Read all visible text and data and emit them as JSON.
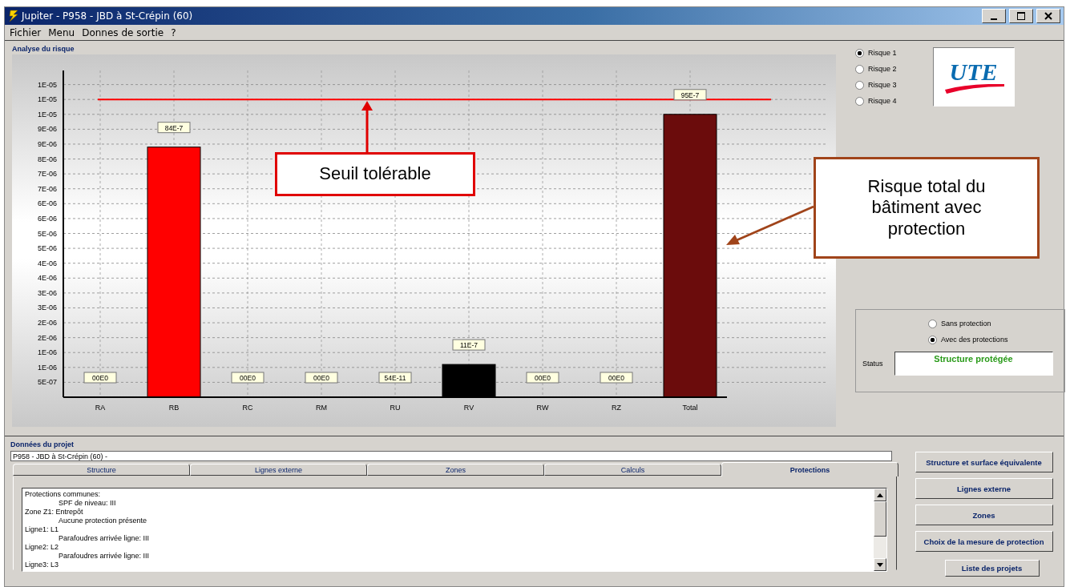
{
  "window": {
    "title": "Jupiter - P958 -  JBD à St-Crépin (60)"
  },
  "menu": [
    "Fichier",
    "Menu",
    "Donnes de sortie",
    "?"
  ],
  "analysis": {
    "title": "Analyse du risque",
    "chart_data": {
      "type": "bar",
      "categories": [
        "RA",
        "RB",
        "RC",
        "RM",
        "RU",
        "RV",
        "RW",
        "RZ",
        "Total"
      ],
      "series": [
        {
          "color": "#ff0000",
          "values": [
            0,
            8.4e-06,
            0,
            0,
            5.4e-10,
            null,
            0,
            0,
            null
          ]
        },
        {
          "color": "#000000",
          "values": [
            null,
            null,
            null,
            null,
            null,
            1.1e-06,
            null,
            null,
            null
          ]
        },
        {
          "color": "#6b0c0c",
          "values": [
            null,
            null,
            null,
            null,
            null,
            null,
            null,
            null,
            9.5e-06
          ]
        }
      ],
      "grid": true,
      "value_labels": [
        "00E0",
        "84E-7",
        "00E0",
        "00E0",
        "54E-11",
        "11E-7",
        "00E0",
        "00E0",
        "95E-7"
      ],
      "ylim": [
        0,
        1.1e-05
      ],
      "yticks": [
        {
          "value": 5e-07,
          "label": "5E-07"
        },
        {
          "value": 1e-06,
          "label": "1E-06"
        },
        {
          "value": 1.5e-06,
          "label": "1E-06"
        },
        {
          "value": 2e-06,
          "label": "2E-06"
        },
        {
          "value": 2.5e-06,
          "label": "2E-06"
        },
        {
          "value": 3e-06,
          "label": "3E-06"
        },
        {
          "value": 3.5e-06,
          "label": "3E-06"
        },
        {
          "value": 4e-06,
          "label": "4E-06"
        },
        {
          "value": 4.5e-06,
          "label": "4E-06"
        },
        {
          "value": 5e-06,
          "label": "5E-06"
        },
        {
          "value": 5.5e-06,
          "label": "5E-06"
        },
        {
          "value": 6e-06,
          "label": "6E-06"
        },
        {
          "value": 6.5e-06,
          "label": "6E-06"
        },
        {
          "value": 7e-06,
          "label": "7E-06"
        },
        {
          "value": 7.5e-06,
          "label": "7E-06"
        },
        {
          "value": 8e-06,
          "label": "8E-06"
        },
        {
          "value": 8.5e-06,
          "label": "9E-06"
        },
        {
          "value": 9e-06,
          "label": "9E-06"
        },
        {
          "value": 9.5e-06,
          "label": "1E-05"
        },
        {
          "value": 1e-05,
          "label": "1E-05"
        },
        {
          "value": 1.05e-05,
          "label": "1E-05"
        }
      ],
      "ref_lines": [
        {
          "axis": "y",
          "value": 1e-05,
          "color": "#ff0000"
        }
      ]
    },
    "callouts": [
      {
        "text": "Seuil tolérable",
        "color": "#e00000"
      },
      {
        "text": "Risque total du bâtiment avec protection",
        "color": "#a0441a"
      }
    ]
  },
  "logo": {
    "text": "UTE"
  },
  "risks": [
    {
      "label": "Risque 1",
      "selected": true
    },
    {
      "label": "Risque 2",
      "selected": false
    },
    {
      "label": "Risque 3",
      "selected": false
    },
    {
      "label": "Risque 4",
      "selected": false
    }
  ],
  "protection_modes": [
    {
      "label": "Sans protection",
      "selected": false
    },
    {
      "label": "Avec des protections",
      "selected": true
    }
  ],
  "status": {
    "label": "Status",
    "value": "Structure protégée"
  },
  "project": {
    "title": "Données du projet",
    "name": "P958 - JBD à St-Crépin (60) -",
    "tabs": [
      {
        "label": "Structure",
        "selected": false
      },
      {
        "label": "Lignes externe",
        "selected": false
      },
      {
        "label": "Zones",
        "selected": false
      },
      {
        "label": "Calculs",
        "selected": false
      },
      {
        "label": "Protections",
        "selected": true
      }
    ],
    "details": [
      {
        "text": "Protections communes:",
        "children": [
          {
            "text": "SPF de niveau: III"
          }
        ]
      },
      {
        "text": "Zone Z1: Entrepôt",
        "children": [
          {
            "text": "Aucune protection présente"
          }
        ]
      },
      {
        "text": "Ligne1: L1",
        "children": [
          {
            "text": "Parafoudres arrivée ligne: III"
          }
        ]
      },
      {
        "text": "Ligne2: L2",
        "children": [
          {
            "text": "Parafoudres arrivée ligne: III"
          }
        ]
      },
      {
        "text": "Ligne3: L3"
      }
    ]
  },
  "buttons": [
    "Structure et surface équivalente",
    "Lignes externe",
    "Zones",
    "Choix de la mesure de protection",
    "Liste des projets"
  ]
}
